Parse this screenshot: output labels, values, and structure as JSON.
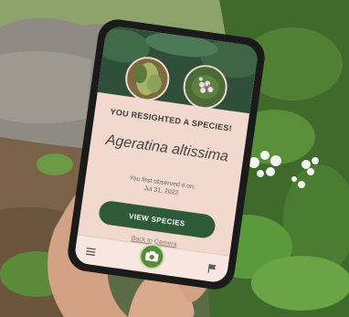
{
  "app": {
    "headline": "YOU RESIGHTED A SPECIES!",
    "species_name": "Ageratina altissima",
    "first_observed_label": "You first observed it on:",
    "first_observed_date": "Jul 31, 2022",
    "view_button_label": "VIEW SPECIES",
    "back_link_label": "Back to Camera"
  },
  "icons": {
    "menu": "menu-icon",
    "camera": "camera-icon",
    "flag": "flag-icon"
  },
  "colors": {
    "card_background": "#f2d9cf",
    "header_green": "#2f4f3a",
    "button_green": "#2f5a3a",
    "camera_green": "#5a8a3a"
  }
}
